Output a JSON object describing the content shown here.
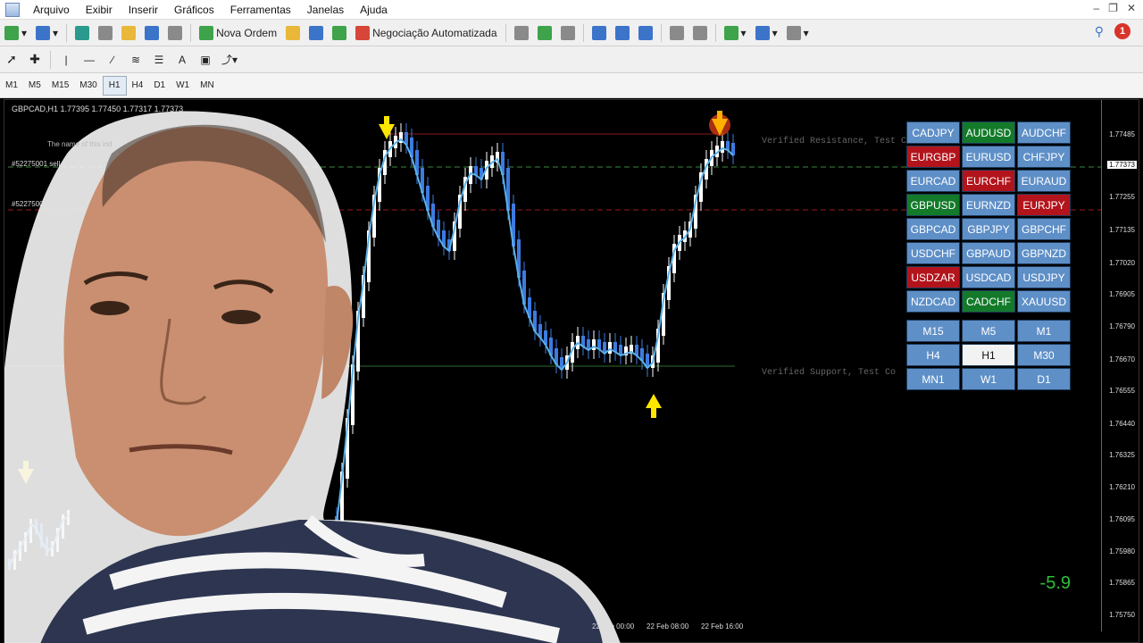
{
  "menu": {
    "items": [
      "Arquivo",
      "Exibir",
      "Inserir",
      "Gráficos",
      "Ferramentas",
      "Janelas",
      "Ajuda"
    ]
  },
  "toolbar": {
    "new_order_label": "Nova Ordem",
    "auto_trading_label": "Negociação Automatizada",
    "notification_count": "1"
  },
  "timeframes": [
    "M1",
    "M5",
    "M15",
    "M30",
    "H1",
    "H4",
    "D1",
    "W1",
    "MN"
  ],
  "active_timeframe": "H1",
  "chart": {
    "header": "GBPCAD,H1  1.77395 1.77450 1.77317 1.77373",
    "order_sell_label": "#52275001 sell 0.01",
    "order_tp_label": "#52275001 tp",
    "indicator_note": "The name of this ind",
    "resistance_label": "Verified Resistance, Test Co",
    "support_label": "Verified Support, Test Co",
    "current_price": "1.77373",
    "big_value": "-5.9",
    "price_labels": [
      "1.77485",
      "1.77255",
      "1.77135",
      "1.77020",
      "1.76905",
      "1.76790",
      "1.76670",
      "1.76555",
      "1.76440",
      "1.76325",
      "1.76210",
      "1.76095",
      "1.75980",
      "1.75865",
      "1.75750"
    ],
    "time_labels": [
      "22 Feb 00:00",
      "22 Feb 08:00",
      "22 Feb 16:00"
    ]
  },
  "symbols": [
    {
      "label": "CADJPY",
      "color": "blue"
    },
    {
      "label": "AUDUSD",
      "color": "green"
    },
    {
      "label": "AUDCHF",
      "color": "blue"
    },
    {
      "label": "EURGBP",
      "color": "red"
    },
    {
      "label": "EURUSD",
      "color": "blue"
    },
    {
      "label": "CHFJPY",
      "color": "blue"
    },
    {
      "label": "EURCAD",
      "color": "blue"
    },
    {
      "label": "EURCHF",
      "color": "red"
    },
    {
      "label": "EURAUD",
      "color": "blue"
    },
    {
      "label": "GBPUSD",
      "color": "green"
    },
    {
      "label": "EURNZD",
      "color": "blue"
    },
    {
      "label": "EURJPY",
      "color": "red"
    },
    {
      "label": "GBPCAD",
      "color": "blue"
    },
    {
      "label": "GBPJPY",
      "color": "blue"
    },
    {
      "label": "GBPCHF",
      "color": "blue"
    },
    {
      "label": "USDCHF",
      "color": "blue"
    },
    {
      "label": "GBPAUD",
      "color": "blue"
    },
    {
      "label": "GBPNZD",
      "color": "blue"
    },
    {
      "label": "USDZAR",
      "color": "red"
    },
    {
      "label": "USDCAD",
      "color": "blue"
    },
    {
      "label": "USDJPY",
      "color": "blue"
    },
    {
      "label": "NZDCAD",
      "color": "blue"
    },
    {
      "label": "CADCHF",
      "color": "green"
    },
    {
      "label": "XAUUSD",
      "color": "blue"
    }
  ],
  "tf_buttons": [
    {
      "label": "M15",
      "color": "blue"
    },
    {
      "label": "M5",
      "color": "blue"
    },
    {
      "label": "M1",
      "color": "blue"
    },
    {
      "label": "H4",
      "color": "blue"
    },
    {
      "label": "H1",
      "color": "white"
    },
    {
      "label": "M30",
      "color": "blue"
    },
    {
      "label": "MN1",
      "color": "blue"
    },
    {
      "label": "W1",
      "color": "blue"
    },
    {
      "label": "D1",
      "color": "blue"
    }
  ],
  "colors": {
    "resistance_line": "#8b1a1a",
    "support_line": "#2e6b2e",
    "ma_line": "#5ab0e6",
    "bull_candle": "#ffffff",
    "bear_candle": "#3d7be0",
    "arrow": "#ffe600"
  }
}
